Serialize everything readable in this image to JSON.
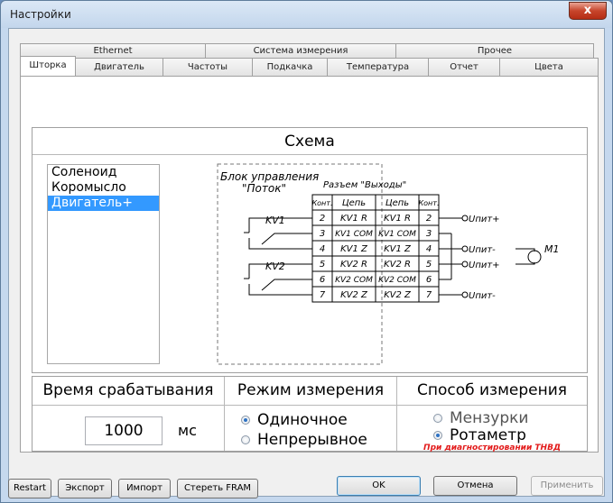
{
  "window": {
    "title": "Настройки",
    "close_glyph": "x"
  },
  "tabs_row1": [
    "Ethernet",
    "Система измерения",
    "Прочее"
  ],
  "tabs_row2": [
    "Шторка",
    "Двигатель",
    "Частоты",
    "Подкачка",
    "Температура",
    "Отчет",
    "Цвета"
  ],
  "active_tab": "Шторка",
  "schema": {
    "title": "Схема",
    "devices": [
      "Соленоид",
      "Коромысло",
      "Двигатель+"
    ],
    "selected_device": "Двигатель+",
    "diagram": {
      "block_label_line1": "Блок управления",
      "block_label_line2": "\"Поток\"",
      "connector_label": "Разъем \"Выходы\"",
      "col_headers": [
        "Конт.",
        "Цепь",
        "Цепь",
        "Конт."
      ],
      "rows": [
        [
          "2",
          "KV1 R",
          "KV1 R",
          "2"
        ],
        [
          "3",
          "KV1 COM",
          "KV1 COM",
          "3"
        ],
        [
          "4",
          "KV1 Z",
          "KV1 Z",
          "4"
        ],
        [
          "5",
          "KV2 R",
          "KV2 R",
          "5"
        ],
        [
          "6",
          "KV2 COM",
          "KV2 COM",
          "6"
        ],
        [
          "7",
          "KV2 Z",
          "KV2 Z",
          "7"
        ]
      ],
      "relay1": "KV1",
      "relay2": "KV2",
      "terminals": [
        "Uпит+",
        "Uпит-",
        "Uпит+",
        "Uпит-"
      ],
      "motor": "M1"
    }
  },
  "measurement": {
    "time_header": "Время срабатывания",
    "time_value": "1000",
    "time_unit": "мс",
    "mode_header": "Режим измерения",
    "mode_single": "Одиночное",
    "mode_continuous": "Непрерывное",
    "mode_selected": "single",
    "method_header": "Способ измерения",
    "method_beakers": "Мензурки",
    "method_rotameter": "Ротаметр",
    "method_selected": "rotameter",
    "method_note": "При диагностировании ТНВД"
  },
  "buttons": {
    "restart": "Restart",
    "export": "Экспорт",
    "import": "Импорт",
    "erase_fram": "Стереть FRAM",
    "ok": "OK",
    "cancel": "Отмена",
    "apply": "Применить"
  },
  "colors": {
    "selection": "#3399ff",
    "note_red": "#e21a1a",
    "radio_on": "#2e72c4"
  }
}
